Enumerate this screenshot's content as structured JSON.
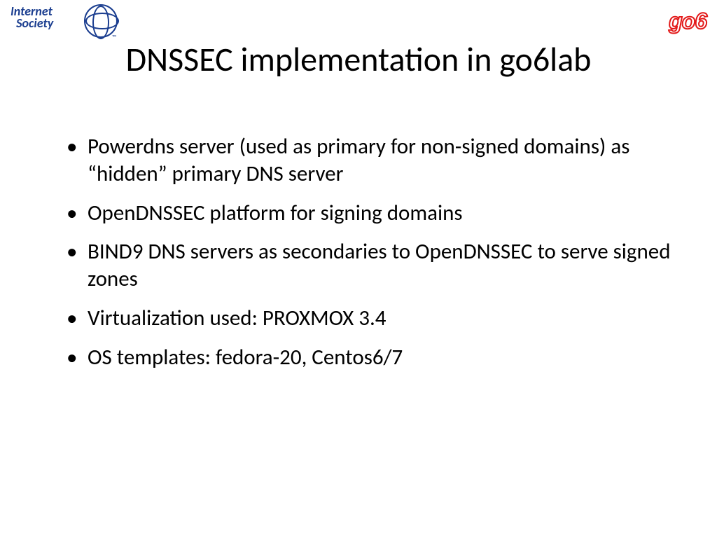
{
  "logo_left": {
    "line1": "Internet",
    "line2": "Society",
    "tm": "™"
  },
  "logo_right": "go6",
  "title": "DNSSEC implementation in go6lab",
  "bullets": [
    "Powerdns server (used as primary for non-signed domains) as “hidden” primary DNS server",
    "OpenDNSSEC platform for signing domains",
    "BIND9 DNS servers as secondaries to OpenDNSSEC to serve signed zones",
    "Virtualization used: PROXMOX 3.4",
    "OS templates: fedora-20, Centos6/7"
  ]
}
